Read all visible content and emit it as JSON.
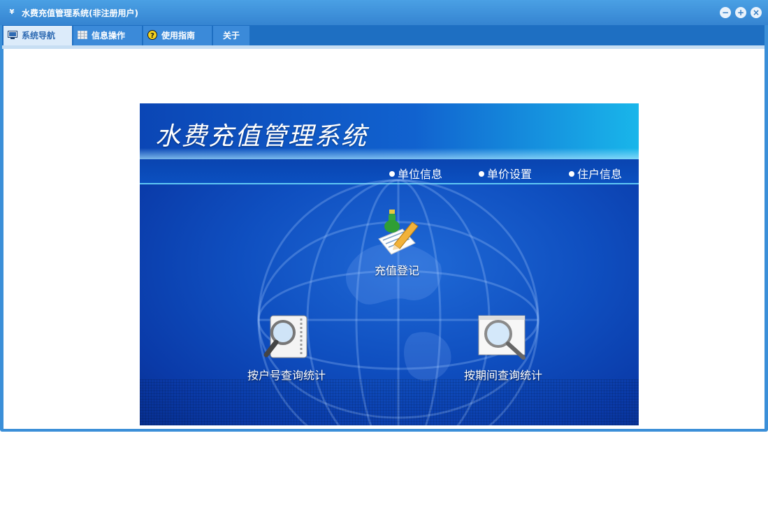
{
  "window": {
    "title": "水费充值管理系统(非注册用户)",
    "app_icon_text": "¥",
    "controls": {
      "minimize": "−",
      "restore": "+",
      "close": "×"
    }
  },
  "tabs": [
    {
      "label": "系统导航",
      "icon": "monitor-icon",
      "active": true
    },
    {
      "label": "信息操作",
      "icon": "grid-icon",
      "active": false
    },
    {
      "label": "使用指南",
      "icon": "help-icon",
      "active": false
    },
    {
      "label": "关于",
      "icon": "",
      "active": false
    }
  ],
  "banner": {
    "title": "水费充值管理系统",
    "menu": [
      "单位信息",
      "单价设置",
      "住户信息"
    ],
    "functions": {
      "recharge": "充值登记",
      "query_by_account": "按户号查询统计",
      "query_by_period": "按期间查询统计"
    }
  },
  "colors": {
    "titlebar": "#3b8fd8",
    "tabbar": "#1e6fc2",
    "active_tab": "#dcebfa",
    "banner_blue": "#0f4fc0"
  }
}
